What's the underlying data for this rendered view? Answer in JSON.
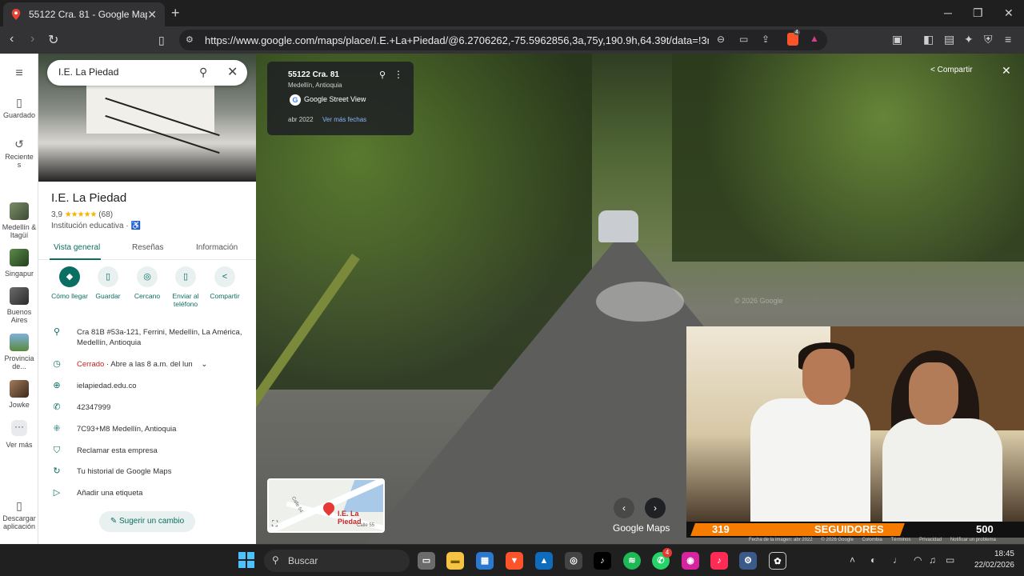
{
  "browser": {
    "tab_title": "55122 Cra. 81 - Google Maps",
    "url": "https://www.google.com/maps/place/I.E.+La+Piedad/@6.2706262,-75.5962856,3a,75y,190.9h,64.39t/data=!3m7!1e1!3m...",
    "brave_badge": "4"
  },
  "rail": {
    "saved": "Guardado",
    "recent": "Recientes",
    "places": [
      "Medellín & Itagüí",
      "Singapur",
      "Buenos Aires",
      "Provincia de...",
      "Jowke"
    ],
    "more": "Ver más",
    "download": "Descargar aplicación"
  },
  "panel": {
    "search_value": "I.E. La Piedad",
    "name": "I.E. La Piedad",
    "rating": "3,9",
    "stars": "★★★★★",
    "reviews": "(68)",
    "category": "Institución educativa",
    "tabs": [
      "Vista general",
      "Reseñas",
      "Información"
    ],
    "actions": [
      "Cómo llegar",
      "Guardar",
      "Cercano",
      "Enviar al teléfono",
      "Compartir"
    ],
    "address": "Cra 81B #53a-121, Ferrini, Medellín, La América, Medellín, Antioquia",
    "hours_status": "Cerrado",
    "hours_detail": " · Abre a las 8 a.m. del lun",
    "website": "ielapiedad.edu.co",
    "phone": "42347999",
    "plus_code": "7C93+M8 Medellín, Antioquia",
    "claim": "Reclamar esta empresa",
    "history": "Tu historial de Google Maps",
    "label": "Añadir una etiqueta",
    "suggest": "Sugerir un cambio"
  },
  "streetview": {
    "title": "55122 Cra. 81",
    "subtitle": "Medellín, Antioquia",
    "provider": "Google Street View",
    "date": "abr 2022",
    "more_dates": "Ver más fechas",
    "share": "Compartir",
    "watermark": "© 2026 Google",
    "logo": "Google Maps",
    "minimap_label": "I.E. La Piedad",
    "minimap_street1": "Calle 54",
    "minimap_street2": "Calle 55",
    "legal": [
      "Fecha de la imagen: abr 2022",
      "© 2026 Google",
      "Colombia",
      "Términos",
      "Privacidad",
      "Notificar un problema"
    ]
  },
  "webcam": {
    "left_number": "319",
    "label": "SEGUIDORES",
    "right_number": "500"
  },
  "taskbar": {
    "search_placeholder": "Buscar",
    "whatsapp_badge": "4",
    "time": "18:45",
    "date": "22/02/2026"
  }
}
